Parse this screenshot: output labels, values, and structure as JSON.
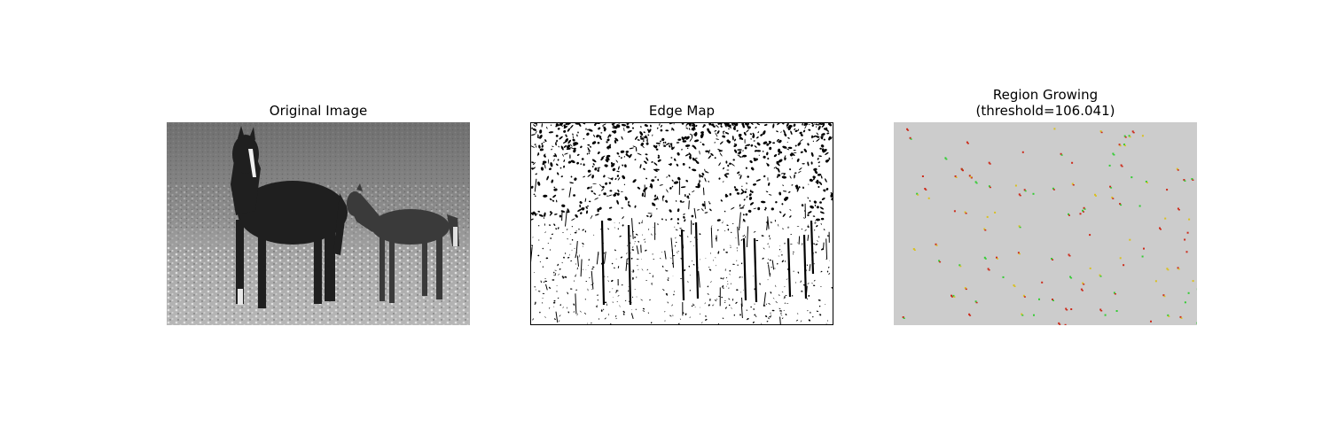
{
  "figure": {
    "panels": [
      {
        "title": "Original Image"
      },
      {
        "title": "Edge Map"
      },
      {
        "title_line1": "Region Growing",
        "title_line2": "(threshold=106.041)"
      }
    ],
    "colors": {
      "background": "#ffffff",
      "region_fill": "#cccccc",
      "seed_green": "#33cc33",
      "seed_red": "#cc2a1a",
      "seed_yellow": "#d9c020",
      "edge_ink": "#000000"
    }
  }
}
